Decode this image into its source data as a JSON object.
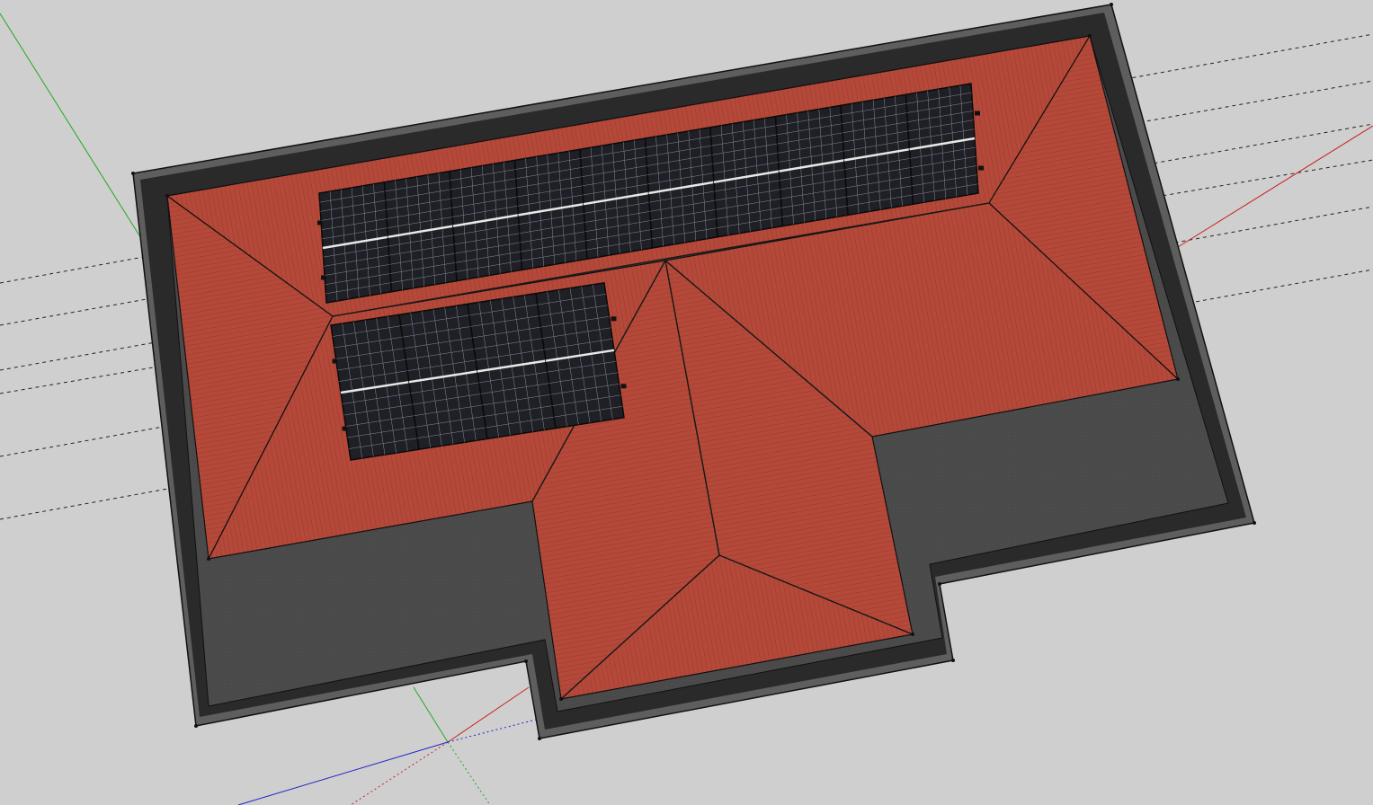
{
  "app": {
    "view": "3d-model-viewport",
    "background_color": "#cfcfcf"
  },
  "model": {
    "subject": "hip-roof-with-solar-panels",
    "colors": {
      "roof_tile": "#b4493a",
      "flat_roof": "#4a4a4a",
      "parapet_outer": "#5e5e5e",
      "parapet_inner": "#2a2a2a",
      "panel_cell": "#1f1f26",
      "panel_grid": "#8a8a96",
      "ridge_line": "#1a1a1a",
      "guide_line": "#222222"
    },
    "solar_arrays": [
      {
        "name": "upper-array",
        "panel_count": 10
      },
      {
        "name": "lower-array",
        "panel_count": 4
      }
    ]
  },
  "axes": {
    "red_axis_color": "#cc2222",
    "green_axis_color": "#22aa22",
    "blue_axis_color": "#2222cc"
  }
}
